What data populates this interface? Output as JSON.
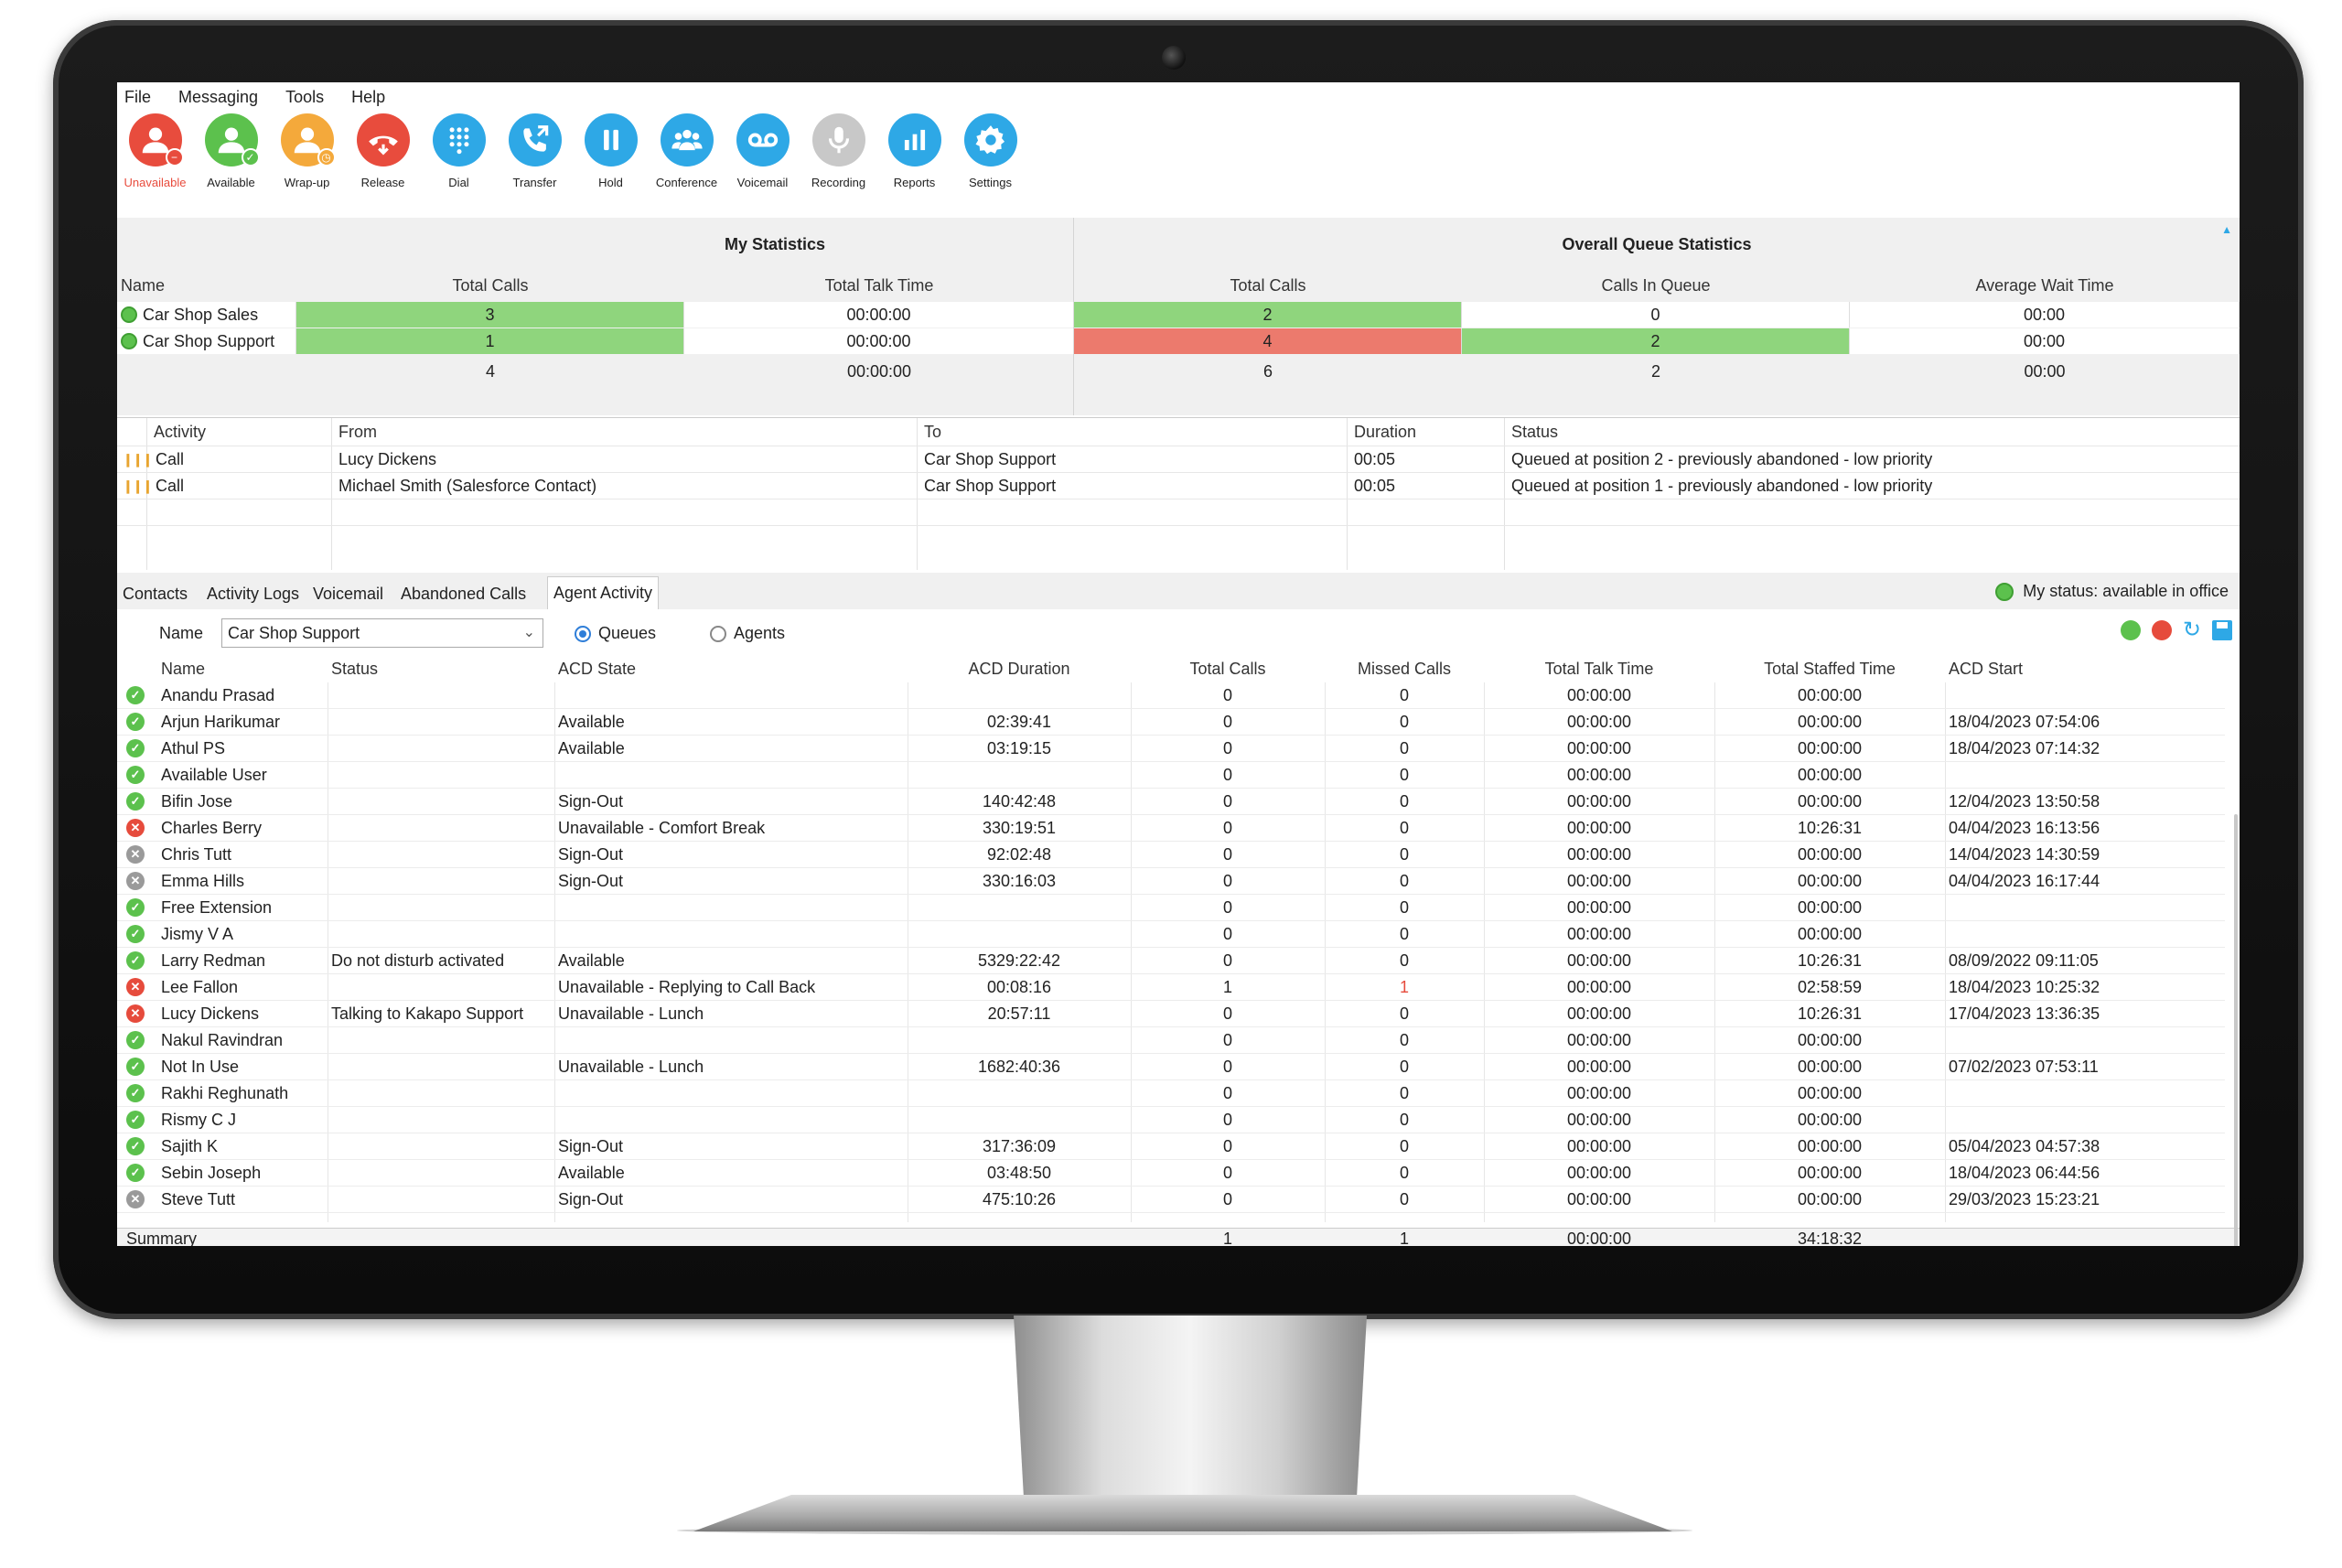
{
  "menu": [
    "File",
    "Messaging",
    "Tools",
    "Help"
  ],
  "toolbar": [
    {
      "label": "Unavailable",
      "icon": "user-unavailable-icon",
      "color": "#e84c3d",
      "label_color": "#e84c3d",
      "badge": "−",
      "badge_color": "#e84c3d"
    },
    {
      "label": "Available",
      "icon": "user-available-icon",
      "color": "#5cc14d",
      "label_color": "#222",
      "badge": "✓",
      "badge_color": "#5cc14d"
    },
    {
      "label": "Wrap-up",
      "icon": "user-wrapup-icon",
      "color": "#f4a93b",
      "label_color": "#222",
      "badge": "◷",
      "badge_color": "#f4a93b"
    },
    {
      "label": "Release",
      "icon": "release-icon",
      "color": "#e84c3d",
      "label_color": "#222"
    },
    {
      "label": "Dial",
      "icon": "dialpad-icon",
      "color": "#2ea8e6",
      "label_color": "#222"
    },
    {
      "label": "Transfer",
      "icon": "transfer-icon",
      "color": "#2ea8e6",
      "label_color": "#222"
    },
    {
      "label": "Hold",
      "icon": "hold-icon",
      "color": "#2ea8e6",
      "label_color": "#222"
    },
    {
      "label": "Conference",
      "icon": "conference-icon",
      "color": "#2ea8e6",
      "label_color": "#222"
    },
    {
      "label": "Voicemail",
      "icon": "voicemail-icon",
      "color": "#2ea8e6",
      "label_color": "#222"
    },
    {
      "label": "Recording",
      "icon": "microphone-icon",
      "color": "#c8c8c8",
      "label_color": "#222"
    },
    {
      "label": "Reports",
      "icon": "reports-icon",
      "color": "#2ea8e6",
      "label_color": "#222"
    },
    {
      "label": "Settings",
      "icon": "gear-icon",
      "color": "#2ea8e6",
      "label_color": "#222"
    }
  ],
  "stats": {
    "my_title": "My Statistics",
    "overall_title": "Overall Queue Statistics",
    "columns": [
      "Name",
      "Total Calls",
      "Total Talk Time",
      "Total Calls",
      "Calls In Queue",
      "Average Wait Time"
    ],
    "rows": [
      {
        "name": "Car Shop Sales",
        "my_total_calls": "3",
        "my_talk_time": "00:00:00",
        "q_total_calls": "2",
        "calls_in_queue": "0",
        "avg_wait": "00:00"
      },
      {
        "name": "Car Shop Support",
        "my_total_calls": "1",
        "my_talk_time": "00:00:00",
        "q_total_calls": "4",
        "calls_in_queue": "2",
        "avg_wait": "00:00"
      }
    ],
    "totals": {
      "my_total_calls": "4",
      "my_talk_time": "00:00:00",
      "q_total_calls": "6",
      "calls_in_queue": "2",
      "avg_wait": "00:00"
    }
  },
  "activity": {
    "columns": [
      "Activity",
      "From",
      "To",
      "Duration",
      "Status"
    ],
    "rows": [
      {
        "activity": "Call",
        "from": "Lucy Dickens",
        "to": "Car Shop Support",
        "duration": "00:05",
        "status": "Queued at position 2 - previously abandoned - low priority"
      },
      {
        "activity": "Call",
        "from": "Michael Smith (Salesforce Contact)",
        "to": "Car Shop Support",
        "duration": "00:05",
        "status": "Queued at position 1 - previously abandoned - low priority"
      }
    ]
  },
  "tabs": [
    "Contacts",
    "Activity Logs",
    "Voicemail",
    "Abandoned Calls",
    "Agent Activity"
  ],
  "my_status": "My status: available in office",
  "filter": {
    "name_label": "Name",
    "name_value": "Car Shop Support",
    "queues_label": "Queues",
    "agents_label": "Agents"
  },
  "agent_columns": [
    "Name",
    "Status",
    "ACD State",
    "ACD Duration",
    "Total Calls",
    "Missed Calls",
    "Total Talk Time",
    "Total Staffed Time",
    "ACD Start"
  ],
  "agents": [
    {
      "state": "available",
      "name": "Anandu Prasad",
      "status": "",
      "acd_state": "",
      "acd_duration": "",
      "total_calls": "0",
      "missed": "0",
      "talk": "00:00:00",
      "staffed": "00:00:00",
      "acd_start": ""
    },
    {
      "state": "available",
      "name": "Arjun Harikumar",
      "status": "",
      "acd_state": "Available",
      "acd_duration": "02:39:41",
      "total_calls": "0",
      "missed": "0",
      "talk": "00:00:00",
      "staffed": "00:00:00",
      "acd_start": "18/04/2023 07:54:06"
    },
    {
      "state": "available",
      "name": "Athul PS",
      "status": "",
      "acd_state": "Available",
      "acd_duration": "03:19:15",
      "total_calls": "0",
      "missed": "0",
      "talk": "00:00:00",
      "staffed": "00:00:00",
      "acd_start": "18/04/2023 07:14:32"
    },
    {
      "state": "available",
      "name": "Available User",
      "status": "",
      "acd_state": "",
      "acd_duration": "",
      "total_calls": "0",
      "missed": "0",
      "talk": "00:00:00",
      "staffed": "00:00:00",
      "acd_start": ""
    },
    {
      "state": "available",
      "name": "Bifin Jose",
      "status": "",
      "acd_state": "Sign-Out",
      "acd_duration": "140:42:48",
      "total_calls": "0",
      "missed": "0",
      "talk": "00:00:00",
      "staffed": "00:00:00",
      "acd_start": "12/04/2023 13:50:58"
    },
    {
      "state": "unavailable",
      "name": "Charles Berry",
      "status": "",
      "acd_state": "Unavailable - Comfort Break",
      "acd_duration": "330:19:51",
      "total_calls": "0",
      "missed": "0",
      "talk": "00:00:00",
      "staffed": "10:26:31",
      "acd_start": "04/04/2023 16:13:56"
    },
    {
      "state": "signout",
      "name": "Chris Tutt",
      "status": "",
      "acd_state": "Sign-Out",
      "acd_duration": "92:02:48",
      "total_calls": "0",
      "missed": "0",
      "talk": "00:00:00",
      "staffed": "00:00:00",
      "acd_start": "14/04/2023 14:30:59"
    },
    {
      "state": "signout",
      "name": "Emma Hills",
      "status": "",
      "acd_state": "Sign-Out",
      "acd_duration": "330:16:03",
      "total_calls": "0",
      "missed": "0",
      "talk": "00:00:00",
      "staffed": "00:00:00",
      "acd_start": "04/04/2023 16:17:44"
    },
    {
      "state": "available",
      "name": "Free Extension",
      "status": "",
      "acd_state": "",
      "acd_duration": "",
      "total_calls": "0",
      "missed": "0",
      "talk": "00:00:00",
      "staffed": "00:00:00",
      "acd_start": ""
    },
    {
      "state": "available",
      "name": "Jismy V A",
      "status": "",
      "acd_state": "",
      "acd_duration": "",
      "total_calls": "0",
      "missed": "0",
      "talk": "00:00:00",
      "staffed": "00:00:00",
      "acd_start": ""
    },
    {
      "state": "available",
      "name": "Larry Redman",
      "status": "Do not disturb activated",
      "acd_state": "Available",
      "acd_duration": "5329:22:42",
      "total_calls": "0",
      "missed": "0",
      "talk": "00:00:00",
      "staffed": "10:26:31",
      "acd_start": "08/09/2022 09:11:05"
    },
    {
      "state": "unavailable",
      "name": "Lee Fallon",
      "status": "",
      "acd_state": "Unavailable - Replying to Call Back",
      "acd_duration": "00:08:16",
      "total_calls": "1",
      "missed": "1",
      "talk": "00:00:00",
      "staffed": "02:58:59",
      "acd_start": "18/04/2023 10:25:32",
      "missed_highlight": true
    },
    {
      "state": "unavailable",
      "name": "Lucy Dickens",
      "status": "Talking to Kakapo Support",
      "acd_state": "Unavailable - Lunch",
      "acd_duration": "20:57:11",
      "total_calls": "0",
      "missed": "0",
      "talk": "00:00:00",
      "staffed": "10:26:31",
      "acd_start": "17/04/2023 13:36:35"
    },
    {
      "state": "available",
      "name": "Nakul Ravindran",
      "status": "",
      "acd_state": "",
      "acd_duration": "",
      "total_calls": "0",
      "missed": "0",
      "talk": "00:00:00",
      "staffed": "00:00:00",
      "acd_start": ""
    },
    {
      "state": "available",
      "name": "Not In Use",
      "status": "",
      "acd_state": "Unavailable - Lunch",
      "acd_duration": "1682:40:36",
      "total_calls": "0",
      "missed": "0",
      "talk": "00:00:00",
      "staffed": "00:00:00",
      "acd_start": "07/02/2023 07:53:11"
    },
    {
      "state": "available",
      "name": "Rakhi Reghunath",
      "status": "",
      "acd_state": "",
      "acd_duration": "",
      "total_calls": "0",
      "missed": "0",
      "talk": "00:00:00",
      "staffed": "00:00:00",
      "acd_start": ""
    },
    {
      "state": "available",
      "name": "Rismy C J",
      "status": "",
      "acd_state": "",
      "acd_duration": "",
      "total_calls": "0",
      "missed": "0",
      "talk": "00:00:00",
      "staffed": "00:00:00",
      "acd_start": ""
    },
    {
      "state": "available",
      "name": "Sajith K",
      "status": "",
      "acd_state": "Sign-Out",
      "acd_duration": "317:36:09",
      "total_calls": "0",
      "missed": "0",
      "talk": "00:00:00",
      "staffed": "00:00:00",
      "acd_start": "05/04/2023 04:57:38"
    },
    {
      "state": "available",
      "name": "Sebin Joseph",
      "status": "",
      "acd_state": "Available",
      "acd_duration": "03:48:50",
      "total_calls": "0",
      "missed": "0",
      "talk": "00:00:00",
      "staffed": "00:00:00",
      "acd_start": "18/04/2023 06:44:56"
    },
    {
      "state": "signout",
      "name": "Steve Tutt",
      "status": "",
      "acd_state": "Sign-Out",
      "acd_duration": "475:10:26",
      "total_calls": "0",
      "missed": "0",
      "talk": "00:00:00",
      "staffed": "00:00:00",
      "acd_start": "29/03/2023 15:23:21"
    }
  ],
  "summary": {
    "label": "Summary",
    "total_calls": "1",
    "missed": "1",
    "talk": "00:00:00",
    "staffed": "34:18:32"
  },
  "colors": {
    "green_cell": "#8fd57d",
    "red_cell": "#ec7a6d",
    "available": "#5cc14d",
    "unavailable": "#e64b3c",
    "signout": "#9a9a9a",
    "accent": "#2ea8e6"
  }
}
